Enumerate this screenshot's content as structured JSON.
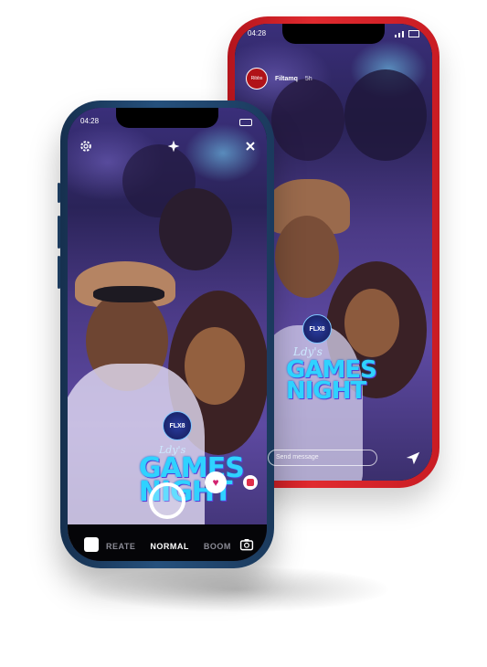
{
  "red_phone": {
    "status_time": "04:28",
    "profile_avatar_text": "Ribbs",
    "profile_name": "Filtamq",
    "post_age": "5h",
    "message_placeholder": "Send message",
    "event_logo_text": "FLX8",
    "event_script": "Ldy's",
    "event_title_line1": "GAMES",
    "event_title_line2": "NIGHT"
  },
  "blue_phone": {
    "status_time": "04:28",
    "modes": [
      "REATE",
      "NORMAL",
      "BOOM"
    ],
    "active_mode": "NORMAL",
    "event_logo_text": "FLX8",
    "event_script": "Ldy's",
    "event_title_line1": "GAMES",
    "event_title_line2": "NIGHT",
    "icons": [
      "settings-icon",
      "sparkle-icon",
      "close-icon",
      "heart-icon",
      "effects-icon",
      "gallery-icon",
      "flip-camera-icon",
      "capture-button"
    ]
  },
  "colors": {
    "red_body": "#e02a2f",
    "blue_body": "#25507c",
    "title_cyan": "#2fd2ff",
    "heart_pink": "#d2226f"
  }
}
